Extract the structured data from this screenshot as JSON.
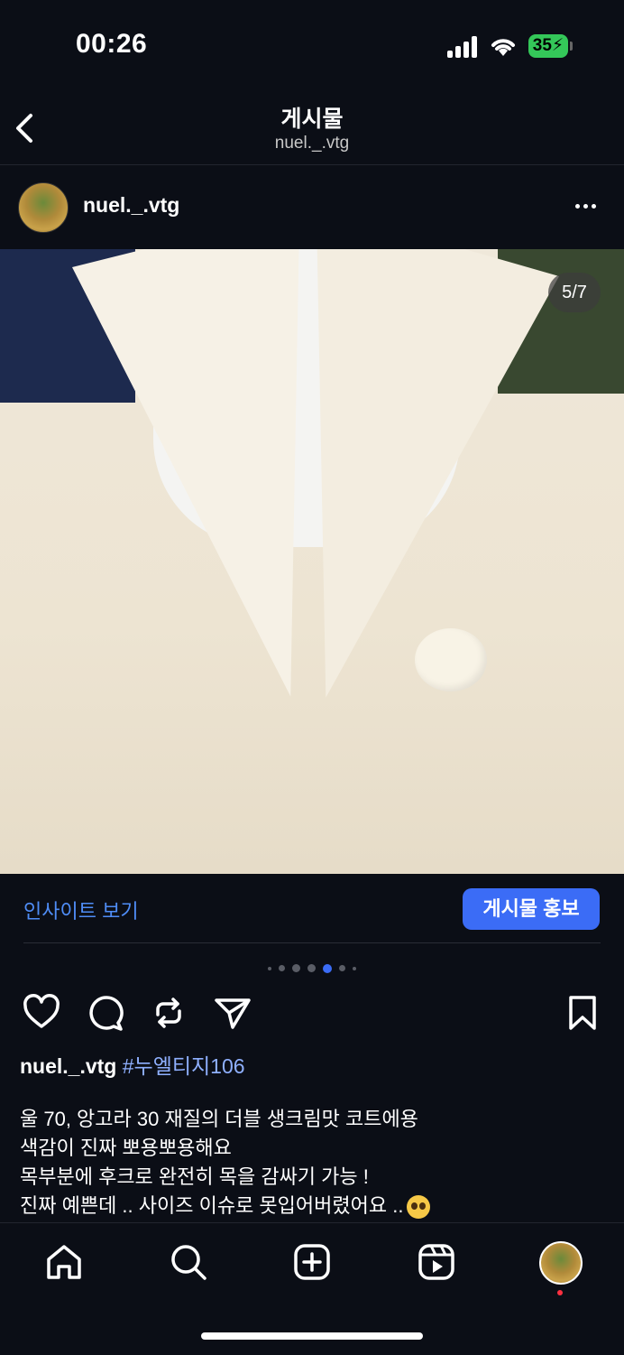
{
  "status_bar": {
    "time": "00:26",
    "battery": "35"
  },
  "nav": {
    "title": "게시물",
    "subtitle": "nuel._.vtg"
  },
  "post": {
    "username": "nuel._.vtg",
    "image_counter": "5/7",
    "carousel": {
      "total": 7,
      "active_index": 4
    }
  },
  "insights": {
    "view_insights": "인사이트 보기",
    "promote": "게시물 홍보"
  },
  "caption": {
    "username": "nuel._.vtg",
    "hashtag": "#누엘티지106",
    "lines": [
      "울 70, 앙고라 30 재질의 더블 생크림맛 코트에용",
      "색감이 진짜 뽀용뽀용해요",
      "목부분에 후크로 완전히 목을 감싸기 가능 !",
      "진짜 예쁜데 .. 사이즈 이슈로 못입어버렸어요 .."
    ]
  },
  "colors": {
    "background": "#0b0e16",
    "accent": "#3b6cf6",
    "link": "#4f8df7",
    "hashtag": "#8fb0ff",
    "battery": "#34c759"
  },
  "icons": [
    "back-chevron-icon",
    "more-icon",
    "heart-icon",
    "comment-icon",
    "repost-icon",
    "share-icon",
    "bookmark-icon",
    "home-icon",
    "search-icon",
    "create-icon",
    "reels-icon",
    "profile-icon"
  ]
}
